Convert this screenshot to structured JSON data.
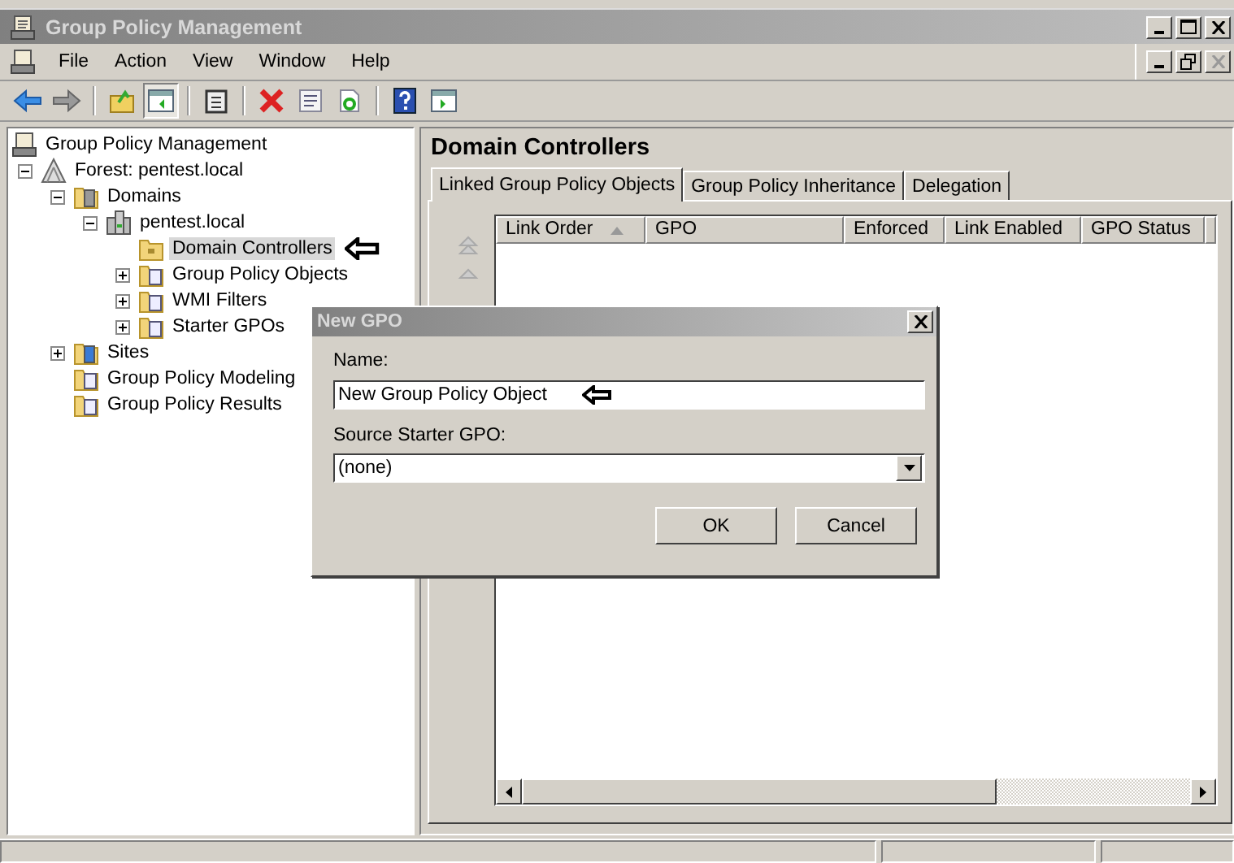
{
  "window": {
    "title": "Group Policy Management"
  },
  "menu": [
    "File",
    "Action",
    "View",
    "Window",
    "Help"
  ],
  "toolbar": [
    {
      "kind": "back",
      "pressed": false
    },
    {
      "kind": "forward",
      "pressed": false
    },
    {
      "kind": "separator"
    },
    {
      "kind": "up",
      "pressed": false
    },
    {
      "kind": "tree",
      "pressed": true
    },
    {
      "kind": "separator"
    },
    {
      "kind": "clipboard",
      "pressed": false
    },
    {
      "kind": "separator"
    },
    {
      "kind": "delete",
      "pressed": false
    },
    {
      "kind": "properties",
      "pressed": false
    },
    {
      "kind": "refresh",
      "pressed": false
    },
    {
      "kind": "separator"
    },
    {
      "kind": "help",
      "pressed": false
    },
    {
      "kind": "pane",
      "pressed": false
    }
  ],
  "tree": [
    {
      "label": "Group Policy Management",
      "kind": "console",
      "selected": false,
      "children": [
        {
          "label": "Forest: pentest.local",
          "kind": "forest",
          "expanded": true,
          "selected": false,
          "children": [
            {
              "label": "Domains",
              "kind": "domains",
              "expanded": true,
              "selected": false,
              "children": [
                {
                  "label": "pentest.local",
                  "kind": "domain",
                  "expanded": true,
                  "selected": false,
                  "children": [
                    {
                      "label": "Domain Controllers",
                      "kind": "ou",
                      "selected": true
                    },
                    {
                      "label": "Group Policy Objects",
                      "kind": "gpos",
                      "expanded": false,
                      "selected": false
                    },
                    {
                      "label": "WMI Filters",
                      "kind": "filters",
                      "expanded": false,
                      "selected": false
                    },
                    {
                      "label": "Starter GPOs",
                      "kind": "starter",
                      "expanded": false,
                      "selected": false
                    }
                  ]
                }
              ]
            },
            {
              "label": "Sites",
              "kind": "sites",
              "expanded": false,
              "selected": false
            },
            {
              "label": "Group Policy Modeling",
              "kind": "modeling",
              "selected": false
            },
            {
              "label": "Group Policy Results",
              "kind": "results",
              "selected": false
            }
          ]
        }
      ]
    }
  ],
  "details": {
    "title": "Domain Controllers",
    "tabs": [
      {
        "label": "Linked Group Policy Objects",
        "selected": true
      },
      {
        "label": "Group Policy Inheritance",
        "selected": false
      },
      {
        "label": "Delegation",
        "selected": false
      }
    ],
    "columns": [
      {
        "label": "Link Order",
        "sorted": true
      },
      {
        "label": "GPO",
        "sorted": false
      },
      {
        "label": "Enforced",
        "sorted": false
      },
      {
        "label": "Link Enabled",
        "sorted": false
      },
      {
        "label": "GPO Status",
        "sorted": false
      }
    ]
  },
  "dialog": {
    "title": "New GPO",
    "name_label": "Name:",
    "name_value": "New Group Policy Object",
    "source_label": "Source Starter GPO:",
    "source_value": "(none)",
    "buttons": [
      "OK",
      "Cancel"
    ]
  }
}
